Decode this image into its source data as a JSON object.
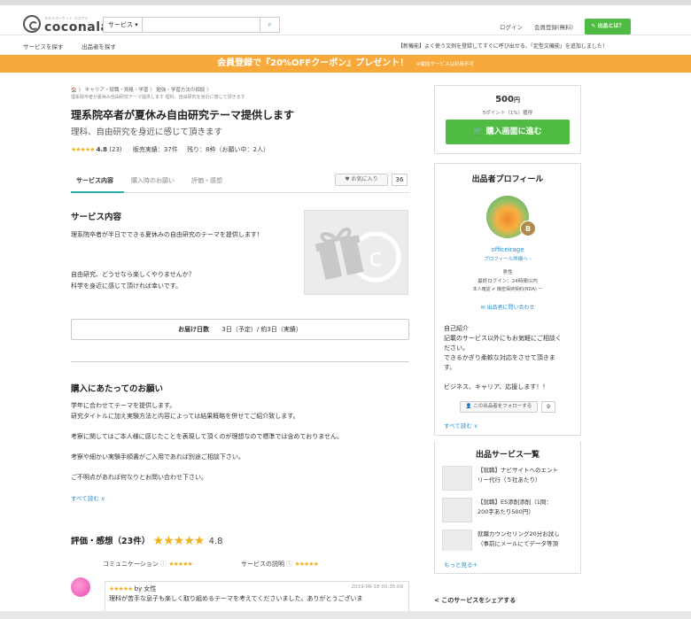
{
  "header": {
    "logo_sub": "スキルマーケット ココナラ",
    "logo_name": "coconala",
    "search_category": "サービス ▾",
    "search_placeholder": "",
    "login": "ログイン",
    "register": "会員登録(無料)",
    "what_button": "✎ 出品とは？"
  },
  "subnav": {
    "find_service": "サービスを探す",
    "find_seller": "出品者を探す",
    "notice": "【新機能】よく使う文例を登録してすぐに呼び出せる、「定型文機能」を追加しました！"
  },
  "banner": {
    "main": "会員登録で『20%OFFクーポン』プレゼント！",
    "note": "※電話サービスは利用不可"
  },
  "breadcrumb": {
    "line1": "🏠  〉 キャリア・就職・資格・学習  〉 勉強・学習方法の相談  〉",
    "line2": "理系院卒者が夏休み自由研究テーマ提供します 理科、自由研究を身近に感じて頂きます"
  },
  "service": {
    "title": "理系院卒者が夏休み自由研究テーマ提供します",
    "subtitle": "理科、自由研究を身近に感じて頂きます",
    "rating_stars": "★★★★★",
    "rating": "4.8",
    "rating_count": "(23)",
    "sales": "販売実績：37件",
    "remaining": "残り：8枠（お願い中：2人）"
  },
  "tabs": {
    "items": [
      "サービス内容",
      "購入時のお願い",
      "評価・感想"
    ],
    "favorite": "♥ お気に入り",
    "favorite_count": "36"
  },
  "content": {
    "heading": "サービス内容",
    "p1": "理系院卒者が半日でできる夏休みの自由研究のテーマを提供します！",
    "p2": "自由研究、どうせなら楽しくやりませんか？",
    "p3": "科学を身近に感じて頂ければ幸いです。",
    "delivery_label": "お届け日数",
    "delivery_value": "3日（予定）/ 約3日（実績）"
  },
  "request": {
    "heading": "購入にあたってのお願い",
    "lines": [
      "学年に合わせてテーマを提供します。",
      "研究タイトルに加え実験方法と内容によっては結果概略を併せてご紹介致します。",
      "考察に関してはご本人様に感じたことを表現して頂くのが理想なので標準では含めておりません。",
      "考察や細かい実験手順書がご入用であれば別途ご相談下さい。",
      "ご不明点があれば何なりとお問い合わせ下さい。"
    ],
    "more": "すべて読む ∨"
  },
  "reviews": {
    "heading": "評価・感想（23件）",
    "stars": "★★★★★",
    "score": "4.8",
    "communication_label": "コミュニケーション",
    "communication_stars": "★★★★★",
    "explanation_label": "サービスの説明",
    "explanation_stars": "★★★★★",
    "item_stars": "★★★★★",
    "item_by": "by 女性",
    "item_date": "2019-06-18 00:35:09",
    "item_text": "理科が苦手な息子も楽しく取り組めるテーマを考えてくださいました。ありがとうございま"
  },
  "purchase": {
    "price": "500",
    "price_unit": "円",
    "points": "5ポイント（1%）獲得",
    "button": "🛒 購入画面に進む"
  },
  "profile": {
    "heading": "出品者プロフィール",
    "badge": "B",
    "name": "officeirage",
    "profile_link": "プロフィール詳細へ ›",
    "gender": "男性",
    "last_login": "最終ログイン：24時間以内",
    "verify": "本人確認 ✔  機密保持契約(NDA) ー",
    "contact": "✉ 出品者に問い合わせ",
    "bio": [
      "自己紹介",
      "記載のサービス以外にもお気軽にご相談く",
      "ださい。",
      "できるかぎり柔軟な対応をさせて頂きま",
      "す。",
      "",
      "ビジネス、キャリア、応援します！！"
    ],
    "follow": "👤 この出品者をフォローする",
    "follow_count": "9",
    "read_more": "すべて読む ∨"
  },
  "seller_services": {
    "heading": "出品サービス一覧",
    "items": [
      [
        "【就職】ナビサイトへのエント",
        "リー代行（５社あたり）"
      ],
      [
        "【就職】ES添削添削（1問：",
        "200字あたり500円）"
      ],
      [
        "就職カウンセリング20分お試し",
        "（事前にメールにてデータ等頂"
      ]
    ],
    "more": "もっと見る＋"
  },
  "share": "< このサービスをシェアする"
}
